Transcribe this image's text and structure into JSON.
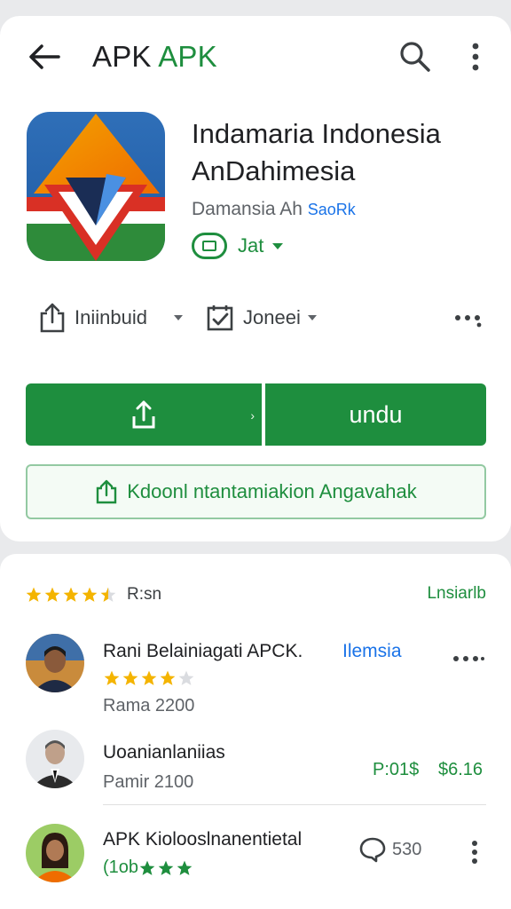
{
  "header": {
    "title_part1": "APK",
    "title_part2": "APK",
    "back_icon": "back-arrow-icon",
    "search_icon": "search-icon",
    "menu_icon": "more-vert-icon"
  },
  "app": {
    "name_line1": "Indamaria Indonesia",
    "name_line2": "AnDahimesia",
    "developer": "Damansia Ah",
    "developer_link": "SaoRk",
    "badge_label": "Jat"
  },
  "actions": {
    "share_label": "Iniinbuid",
    "bookmark_label": "Joneei"
  },
  "buttons": {
    "primary_right_label": "undu",
    "outline_label": "Kdoonl ntantamiakion Angavahak"
  },
  "ratings": {
    "label": "R:sn",
    "see_all": "Lnsiarlb",
    "stars_filled": 4.5
  },
  "reviews": [
    {
      "name": "Rani Belainiagati APCK.",
      "tag": "Ilemsia",
      "stars": 4,
      "date": "Rama 2200"
    },
    {
      "name": "Uoanianlaniias",
      "date": "Pamir 2100",
      "price_a": "P:01$",
      "price_b": "$6.16"
    },
    {
      "name": "APK Kiolooslnanentietal",
      "prefix": "(1ob",
      "stars": 3,
      "count": "530"
    }
  ],
  "colors": {
    "brand_green": "#1e8e3e",
    "star_yellow": "#f4b400",
    "link_blue": "#1a73e8"
  }
}
